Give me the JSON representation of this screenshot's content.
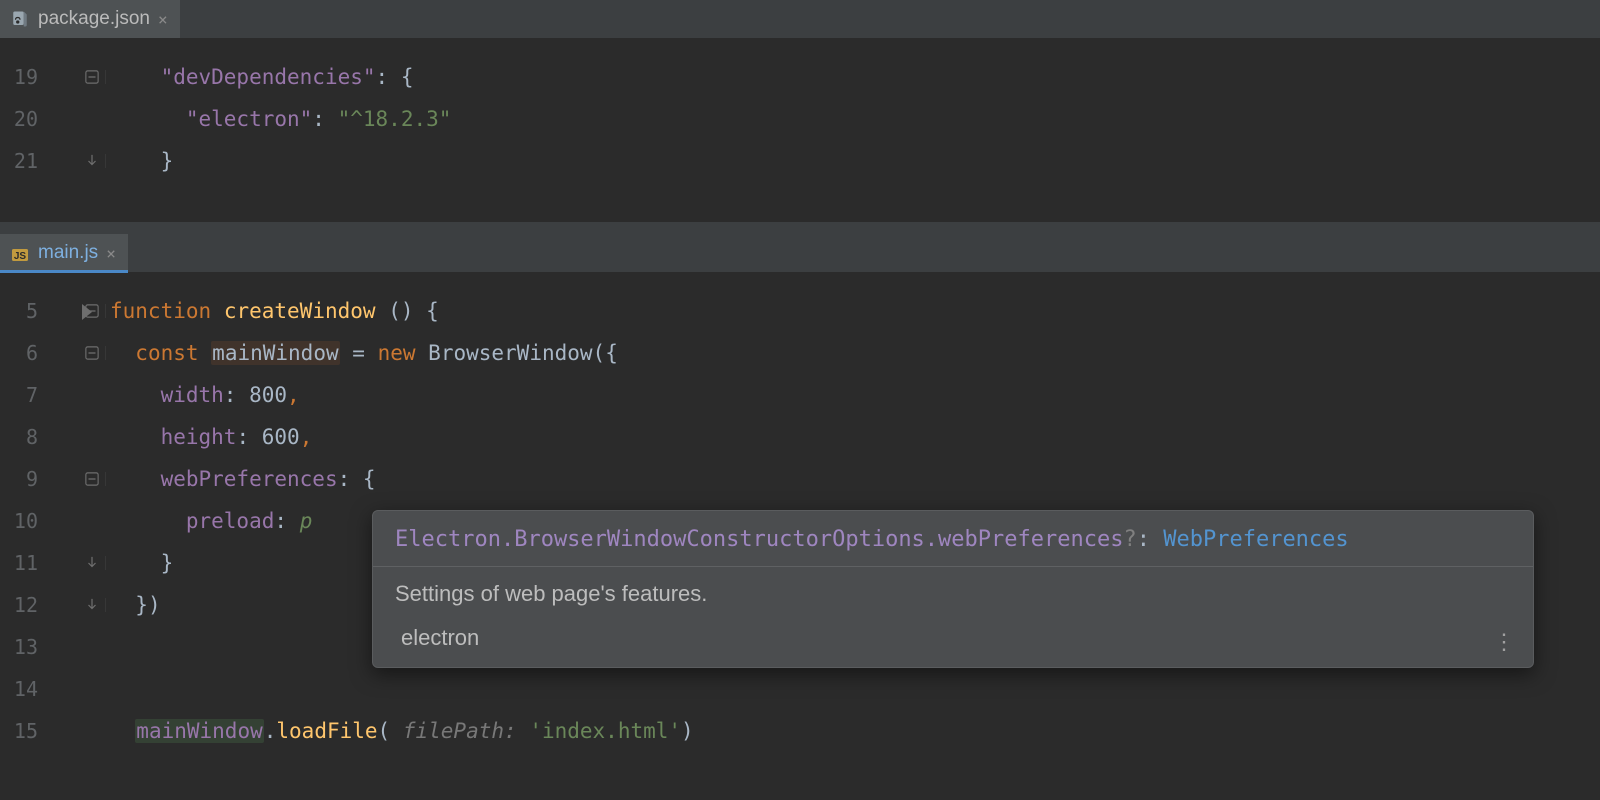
{
  "pane1": {
    "tab": {
      "filename": "package.json"
    },
    "lines": [
      {
        "num": "19"
      },
      {
        "num": "20"
      },
      {
        "num": "21"
      }
    ],
    "code": {
      "devDependencies_key": "\"devDependencies\"",
      "electron_key": "\"electron\"",
      "electron_version": "\"^18.2.3\""
    }
  },
  "pane2": {
    "tab": {
      "filename": "main.js"
    },
    "lines": [
      {
        "num": "5"
      },
      {
        "num": "6"
      },
      {
        "num": "7"
      },
      {
        "num": "8"
      },
      {
        "num": "9"
      },
      {
        "num": "10"
      },
      {
        "num": "11"
      },
      {
        "num": "12"
      },
      {
        "num": "13"
      },
      {
        "num": "14"
      },
      {
        "num": "15"
      }
    ],
    "tokens": {
      "function": "function",
      "createWindow": "createWindow",
      "const": "const",
      "mainWindow": "mainWindow",
      "eq": "=",
      "new": "new",
      "BrowserWindow": "BrowserWindow",
      "width": "width",
      "width_val": "800",
      "height": "height",
      "height_val": "600",
      "webPreferences": "webPreferences",
      "preload": "preload",
      "preload_val_start": "p",
      "loadFile": "loadFile",
      "filePathHint": "filePath:",
      "indexhtml": "'index.html'"
    }
  },
  "doc": {
    "sig_path": "Electron.BrowserWindowConstructorOptions.webPreferences",
    "sig_opt": "?",
    "sig_colon": ": ",
    "sig_type": "WebPreferences",
    "description": "Settings of web page's features.",
    "module": "electron",
    "more": "⋮"
  }
}
